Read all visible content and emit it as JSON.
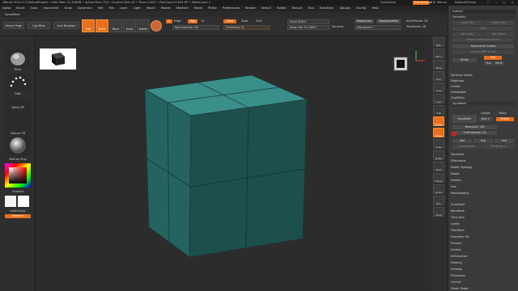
{
  "titlebar": {
    "title": "ZBrush 2022.0.5    DefaultProject  • Free Mem 22.208GB • Active Mem 754 • Scratch Disk 49 • Timer 0.003 • PolyCount 0.024 KP • MeshCount 1",
    "quicksave": "QuickSave",
    "seethrough": "See-through 0",
    "menus_label": "Menus",
    "script": "DefaultZScript"
  },
  "menubar": [
    "Alpha",
    "Brush",
    "Color",
    "Document",
    "Draw",
    "Dynamics",
    "Edit",
    "File",
    "Layer",
    "Light",
    "Macro",
    "Marker",
    "Material",
    "Movie",
    "Picker",
    "Preferences",
    "Render",
    "Stencil",
    "Stroke",
    "Texture",
    "Tool",
    "Transform",
    "Zplugin",
    "Zscript",
    "Help"
  ],
  "tab_title": "DynaMesh",
  "shelf": {
    "home_page": "Home Page",
    "lightbox": "LightBox",
    "live_boolean": "Live Boolean",
    "tools": [
      "Edit",
      "Draw",
      "Move",
      "Scale",
      "Rotate"
    ],
    "a_label": "A",
    "mrgb": "Mrgb",
    "rgb": "Rgb",
    "m": "M",
    "zadd": "Zadd",
    "zsub": "Zsub",
    "zcut": "Zcut",
    "rgb_intensity": "Rgb Intensity 100",
    "z_intensity": "Z Intensity 51",
    "focal_shift": "Focal Shift 0",
    "draw_size": "Draw Size 32.70657",
    "dynamic": "Dynamic",
    "replay_last": "ReplayLast",
    "replay_last_rel": "ReplayLastRel",
    "adjust_last": "AdjustLast 1",
    "active_points": "ActivePoints: 26",
    "total_points": "TotalPoints: 26"
  },
  "left": {
    "brush": "Move",
    "stroke": "Dots",
    "alpha": "Alpha Off",
    "texture": "Texture Off",
    "material": "MatCap Gray",
    "gradient": "Gradient",
    "switch_color": "SwitchColor",
    "alternate": "Alternate"
  },
  "right_shelf": [
    "BPR",
    "SPix 3",
    "Persp",
    "Floor",
    "Local",
    "L.Sym",
    "XYZ",
    "Frame",
    "Move",
    "Scale",
    "Rotate",
    "PolyF",
    "Transp",
    "Ghost",
    "Solo",
    "Xpose"
  ],
  "colors": {
    "accent": "#e86f1b",
    "cube_top": "#3a8f8a",
    "cube_left": "#256360",
    "cube_right": "#1d4f4d",
    "panel": "#3a3a3a",
    "viewport": "#2c2c2c"
  },
  "panel": {
    "subtool": "Subtool",
    "geometry": "Geometry",
    "lower_res": "Lower Res",
    "higher_res": "Higher Res",
    "sdiv": "SDiv",
    "del_lower": "Del Lower",
    "del_higher": "Del Higher",
    "freeze_subdiv": "Freeze SubDivision Levels",
    "reconstruct_subdiv": "Reconstruct Subdiv",
    "convert_bpr": "Convert BPR To Geo",
    "divide": "Divide",
    "smt": "Smt",
    "suv": "Suv",
    "rsuv": "ReUV",
    "dynamic_subdiv": "Dynamic Subdiv",
    "edgeloop": "EdgeLoop",
    "crease": "Crease",
    "shadowbox": "ShadowBox",
    "claypolish": "ClayPolish",
    "dynamesh_section": "DynaMesh",
    "dynamesh_btn": "DynaMesh",
    "groups": "Groups",
    "polish": "Polish",
    "blur": "Blur 2",
    "project": "Project",
    "resolution": "Resolution 128",
    "sub_projection": "SubProjection 0.6",
    "add": "Add",
    "sub": "Sub",
    "and": "And",
    "create_shell": "Create Shell",
    "thickness": "Thickness 4",
    "items": [
      "Tessimate",
      "ZRemesher",
      "Modify Topology",
      "Stager",
      "Position",
      "Size",
      "MeshIntegrity",
      "ArrayMesh",
      "NanoMesh",
      "Thick Skin",
      "Layers",
      "FiberMesh",
      "Geometry HD",
      "Preview",
      "Surface",
      "Deformation",
      "Masking",
      "Visibility",
      "Polygroups",
      "Contact",
      "Morph Target"
    ]
  }
}
